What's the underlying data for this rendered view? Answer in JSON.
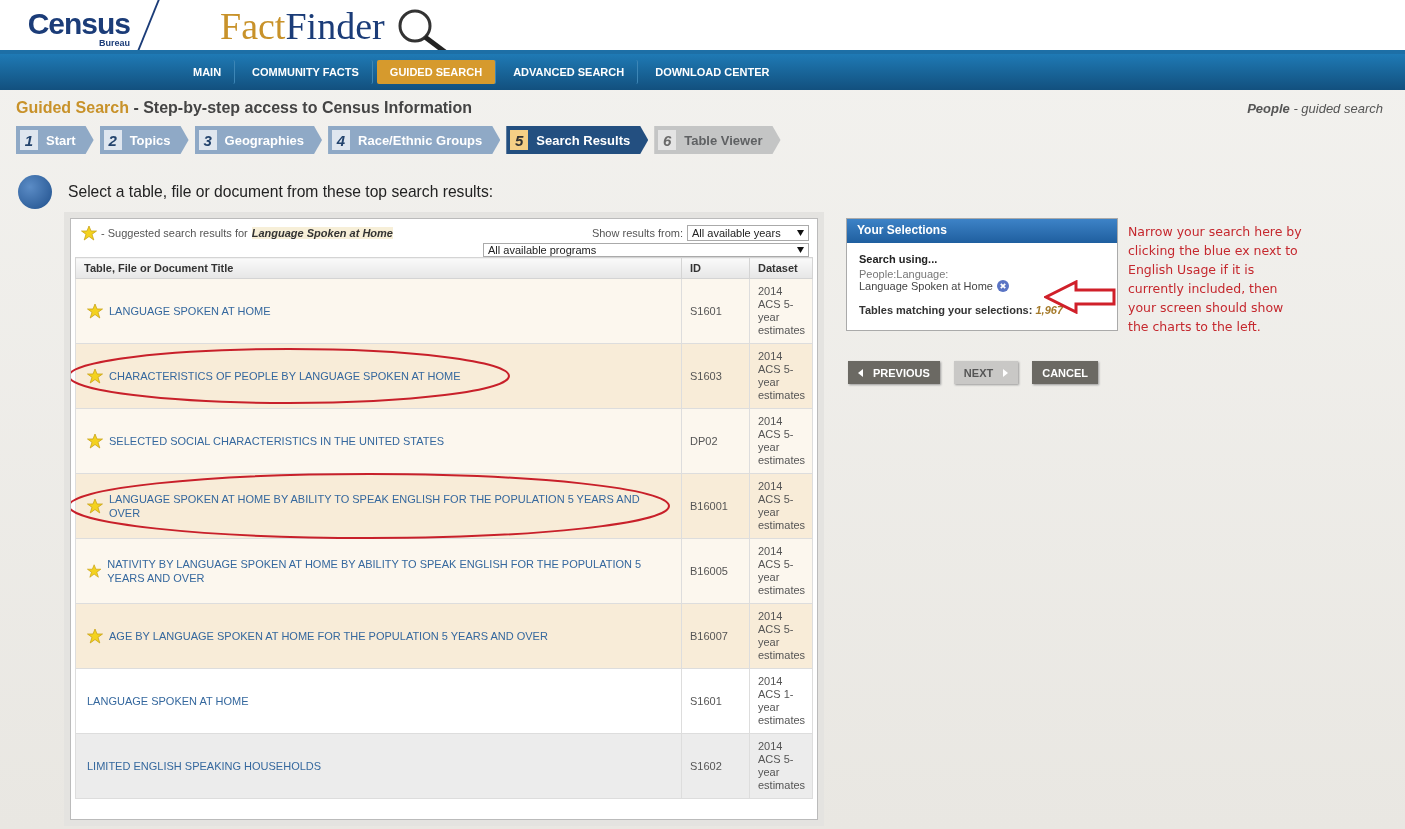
{
  "header": {
    "logo_main": "Census",
    "logo_sub": "Bureau",
    "product_first": "Fact",
    "product_second": "Finder"
  },
  "nav": [
    {
      "label": "MAIN",
      "selected": false
    },
    {
      "label": "COMMUNITY FACTS",
      "selected": false
    },
    {
      "label": "GUIDED SEARCH",
      "selected": true
    },
    {
      "label": "ADVANCED SEARCH",
      "selected": false
    },
    {
      "label": "DOWNLOAD CENTER",
      "selected": false
    }
  ],
  "page_title": {
    "section": "Guided Search",
    "subtitle": "- Step-by-step access to Census Information"
  },
  "context": {
    "topic": "People",
    "mode": "- guided search"
  },
  "steps": [
    {
      "number": "1",
      "label": "Start",
      "selected": false,
      "disabled": false
    },
    {
      "number": "2",
      "label": "Topics",
      "selected": false,
      "disabled": false
    },
    {
      "number": "3",
      "label": "Geographies",
      "selected": false,
      "disabled": false
    },
    {
      "number": "4",
      "label": "Race/Ethnic Groups",
      "selected": false,
      "disabled": false
    },
    {
      "number": "5",
      "label": "Search Results",
      "selected": true,
      "disabled": false
    },
    {
      "number": "6",
      "label": "Table Viewer",
      "selected": false,
      "disabled": true
    }
  ],
  "instruction": "Select a table, file or document from these top search results:",
  "results": {
    "suggested_prefix": "- Suggested search results for",
    "query": "Language Spoken at Home",
    "show_from_label": "Show results from:",
    "year_filter": "All available years",
    "program_filter": "All available programs",
    "columns": [
      "Table, File or Document Title",
      "ID",
      "Dataset"
    ],
    "rows": [
      {
        "title": "LANGUAGE SPOKEN AT HOME",
        "id": "S1601",
        "dataset": "2014 ACS 5-year estimates",
        "suggested": true,
        "circled": false
      },
      {
        "title": "CHARACTERISTICS OF PEOPLE BY LANGUAGE SPOKEN AT HOME",
        "id": "S1603",
        "dataset": "2014 ACS 5-year estimates",
        "suggested": true,
        "circled": true
      },
      {
        "title": "SELECTED SOCIAL CHARACTERISTICS IN THE UNITED STATES",
        "id": "DP02",
        "dataset": "2014 ACS 5-year estimates",
        "suggested": true,
        "circled": false
      },
      {
        "title": "LANGUAGE SPOKEN AT HOME BY ABILITY TO SPEAK ENGLISH FOR THE POPULATION 5 YEARS AND OVER",
        "id": "B16001",
        "dataset": "2014 ACS 5-year estimates",
        "suggested": true,
        "circled": true
      },
      {
        "title": "NATIVITY BY LANGUAGE SPOKEN AT HOME BY ABILITY TO SPEAK ENGLISH FOR THE POPULATION 5 YEARS AND OVER",
        "id": "B16005",
        "dataset": "2014 ACS 5-year estimates",
        "suggested": true,
        "circled": false
      },
      {
        "title": "AGE BY LANGUAGE SPOKEN AT HOME FOR THE POPULATION 5 YEARS AND OVER",
        "id": "B16007",
        "dataset": "2014 ACS 5-year estimates",
        "suggested": true,
        "circled": false
      },
      {
        "title": "LANGUAGE SPOKEN AT HOME",
        "id": "S1601",
        "dataset": "2014 ACS 1-year estimates",
        "suggested": false,
        "circled": false
      },
      {
        "title": "LIMITED ENGLISH SPEAKING HOUSEHOLDS",
        "id": "S1602",
        "dataset": "2014 ACS 5-year estimates",
        "suggested": false,
        "circled": false
      }
    ]
  },
  "selections": {
    "title": "Your Selections",
    "search_using": "Search using...",
    "criterion_path": "People:Language:",
    "criterion": "Language Spoken at Home",
    "matching_label": "Tables matching your selections:",
    "matching_count": "1,967"
  },
  "buttons": [
    {
      "label": "PREVIOUS",
      "kind": "back",
      "disabled": false
    },
    {
      "label": "NEXT",
      "kind": "forward",
      "disabled": true
    },
    {
      "label": "CANCEL",
      "kind": "plain",
      "disabled": false
    }
  ],
  "annotation": "Narrow your search here by clicking the blue ex next to English Usage if it is currently included, then your screen should show the charts to the left."
}
